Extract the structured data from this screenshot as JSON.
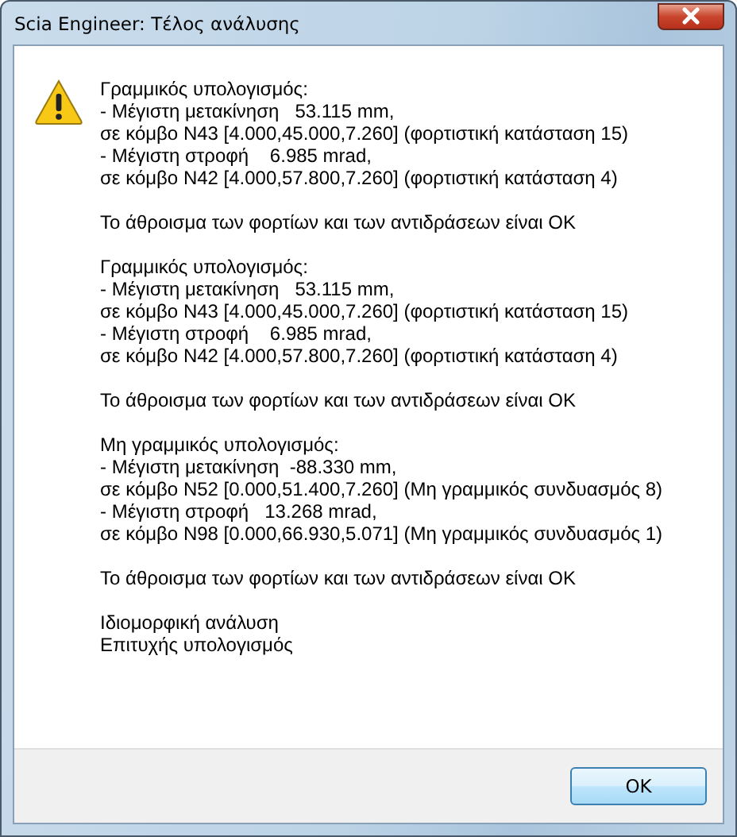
{
  "window": {
    "title": "Scia Engineer:  Τέλος ανάλυσης"
  },
  "message": {
    "blocks": [
      {
        "lines": [
          "Γραμμικός υπολογισμός:",
          "- Μέγιστη μετακίνηση   53.115 mm,",
          "σε κόμβο N43 [4.000,45.000,7.260] (φορτιστική κατάσταση 15)",
          "- Μέγιστη στροφή    6.985 mrad,",
          "σε κόμβο N42 [4.000,57.800,7.260] (φορτιστική κατάσταση 4)"
        ]
      },
      {
        "lines": [
          "Το άθροισμα των φορτίων και των αντιδράσεων είναι OK"
        ]
      },
      {
        "lines": [
          "Γραμμικός υπολογισμός:",
          "- Μέγιστη μετακίνηση   53.115 mm,",
          "σε κόμβο N43 [4.000,45.000,7.260] (φορτιστική κατάσταση 15)",
          "- Μέγιστη στροφή    6.985 mrad,",
          "σε κόμβο N42 [4.000,57.800,7.260] (φορτιστική κατάσταση 4)"
        ]
      },
      {
        "lines": [
          "Το άθροισμα των φορτίων και των αντιδράσεων είναι OK"
        ]
      },
      {
        "lines": [
          "Μη γραμμικός υπολογισμός:",
          "- Μέγιστη μετακίνηση  -88.330 mm,",
          "σε κόμβο N52 [0.000,51.400,7.260] (Μη γραμμικός συνδυασμός 8)",
          "- Μέγιστη στροφή   13.268 mrad,",
          "σε κόμβο N98 [0.000,66.930,5.071] (Μη γραμμικός συνδυασμός 1)"
        ]
      },
      {
        "lines": [
          "Το άθροισμα των φορτίων και των αντιδράσεων είναι OK"
        ]
      },
      {
        "lines": [
          "Ιδιομορφική ανάλυση",
          "Επιτυχής υπολογισμός"
        ]
      }
    ]
  },
  "buttons": [
    "OK"
  ]
}
